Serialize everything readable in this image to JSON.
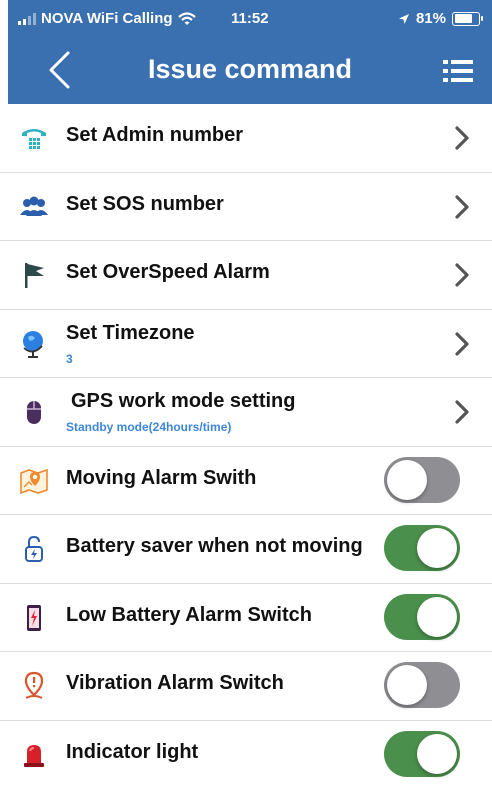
{
  "status_bar": {
    "carrier": "NOVA WiFi Calling",
    "time": "11:52",
    "battery_percent": "81%",
    "battery_level": 0.81
  },
  "nav_bar": {
    "title": "Issue command",
    "back_icon": "chevron-left-icon",
    "menu_icon": "list-menu-icon"
  },
  "colors": {
    "header_bg": "#3a6fb0",
    "toggle_on": "#4a8f4c",
    "toggle_off": "#8e8e93",
    "sublabel": "#3e86d8"
  },
  "commands": [
    {
      "label": "Set Admin number",
      "icon": "telephone-icon"
    },
    {
      "label": "Set SOS number",
      "icon": "people-icon"
    },
    {
      "label": "Set OverSpeed Alarm",
      "icon": "flag-icon"
    },
    {
      "label": "Set Timezone",
      "value": "3",
      "icon": "globe-icon"
    },
    {
      "label": " GPS work mode setting",
      "value": "Standby mode(24hours/time)",
      "icon": "mouse-icon"
    }
  ],
  "switches": [
    {
      "label": "Moving Alarm Swith",
      "on": false,
      "icon": "map-pin-icon"
    },
    {
      "label": "Battery saver when not moving",
      "on": true,
      "icon": "lock-power-icon"
    },
    {
      "label": "Low Battery Alarm Switch",
      "on": true,
      "icon": "phone-battery-icon"
    },
    {
      "label": "Vibration Alarm Switch",
      "on": false,
      "icon": "vibration-pin-icon"
    },
    {
      "label": "Indicator light",
      "on": true,
      "icon": "beacon-light-icon"
    }
  ]
}
